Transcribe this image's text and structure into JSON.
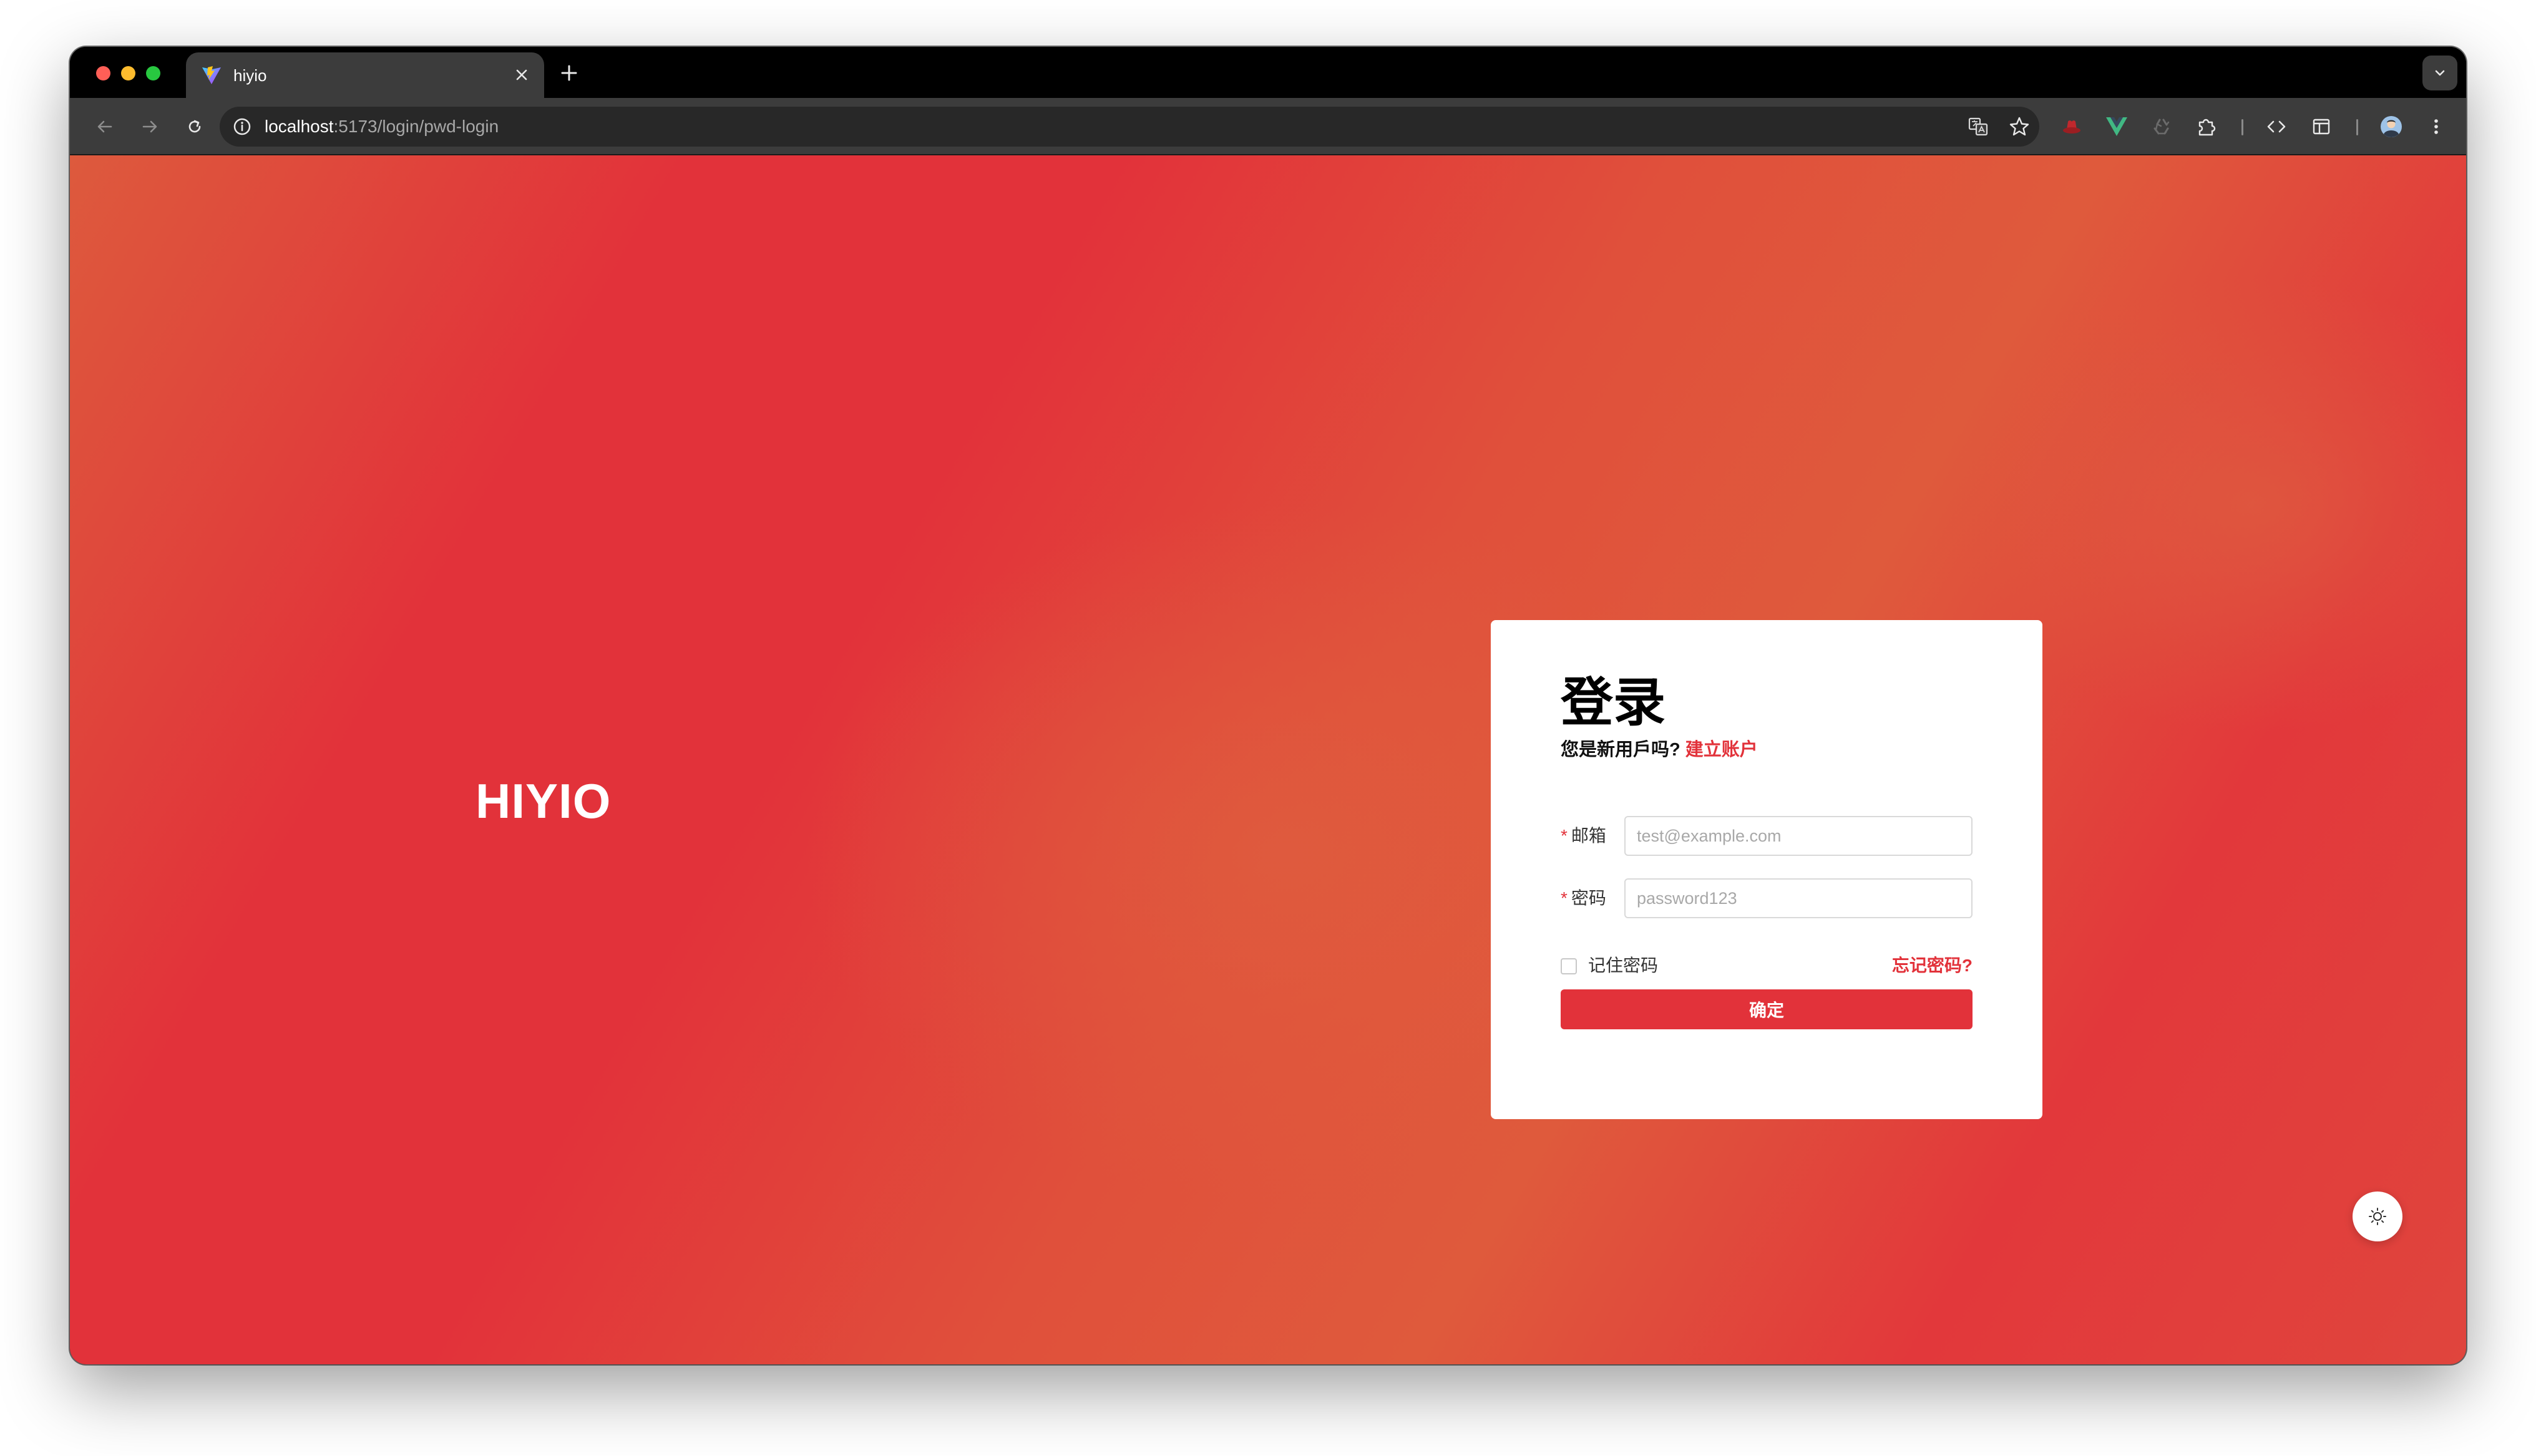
{
  "browser": {
    "tab": {
      "title": "hiyio",
      "favicon": "vite-logo-icon"
    },
    "new_tab_icon": "plus-icon",
    "url": {
      "host": "localhost",
      "path": ":5173/login/pwd-login"
    },
    "extensions": [
      "translate-icon",
      "star-icon",
      "red-hat-icon",
      "vue-devtools-icon",
      "recycle-icon",
      "puzzle-icon",
      "code-icon",
      "layout-panel-icon",
      "profile-avatar-icon",
      "kebab-menu-icon"
    ]
  },
  "page": {
    "brand": "HIYIO",
    "login": {
      "title": "登录",
      "subtitle_prefix": "您是新用戶吗?",
      "subtitle_link": "建立账户",
      "required_mark": "*",
      "email_label": "邮箱",
      "email_placeholder": "test@example.com",
      "password_label": "密码",
      "password_placeholder": "password123",
      "remember_label": "记住密码",
      "forgot_label": "忘记密码?",
      "submit_label": "确定"
    },
    "theme_toggle_icon": "sun-icon"
  },
  "colors": {
    "accent": "#e2323a",
    "background_primary": "#e2323a",
    "background_secondary": "#df5a3c"
  }
}
